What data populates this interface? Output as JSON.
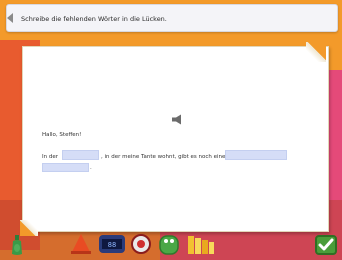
{
  "header": {
    "instruction": "Schreibe die fehlenden Wörter in die Lücken."
  },
  "exercise": {
    "greeting": "Hallo, Steffen!",
    "sentence_part1": "In der",
    "sentence_part2": ", in der meine Tante wohnt, gibt es noch eine",
    "sentence_end": ".",
    "gaps": [
      "",
      "",
      ""
    ]
  },
  "icons": [
    "back-arrow-icon",
    "speaker-icon",
    "bottle-icon",
    "cone-icon",
    "clock-icon",
    "globe-icon",
    "frog-icon",
    "books-icon",
    "check-icon"
  ],
  "colors": {
    "background": "#f39a2a",
    "pink_shape": "#e44a79",
    "gap_fill": "#d5ddf7",
    "check": "#4a9d3a"
  }
}
